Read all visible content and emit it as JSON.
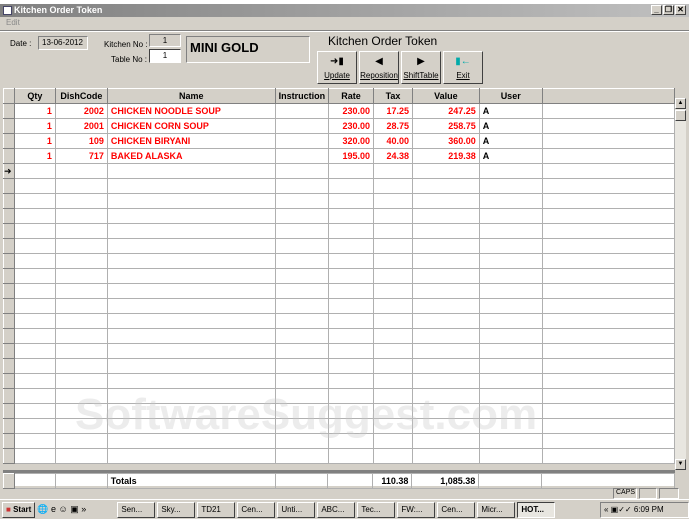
{
  "window": {
    "title": "Kitchen Order Token",
    "menu": "Edit"
  },
  "header": {
    "date_label": "Date :",
    "date": "13-06-2012",
    "kitchen_label": "Kitchen No :",
    "kitchen_no": "1",
    "table_label": "Table No :",
    "table_no": "1",
    "outlet": "MINI GOLD",
    "form_title": "Kitchen Order Token"
  },
  "buttons": [
    {
      "label": "Update",
      "icon": "door-arrow-in"
    },
    {
      "label": "Reposition",
      "icon": "arrow-left"
    },
    {
      "label": "ShiftTable",
      "icon": "arrow-right"
    },
    {
      "label": "Exit",
      "icon": "exit-door"
    }
  ],
  "columns": [
    "Qty",
    "DishCode",
    "Name",
    "Instruction",
    "Rate",
    "Tax",
    "Value",
    "User"
  ],
  "rows": [
    {
      "qty": "1",
      "code": "2002",
      "name": "CHICKEN NOODLE SOUP",
      "instr": "",
      "rate": "230.00",
      "tax": "17.25",
      "value": "247.25",
      "user": "A"
    },
    {
      "qty": "1",
      "code": "2001",
      "name": "CHICKEN CORN SOUP",
      "instr": "",
      "rate": "230.00",
      "tax": "28.75",
      "value": "258.75",
      "user": "A"
    },
    {
      "qty": "1",
      "code": "109",
      "name": "CHICKEN BIRYANI",
      "instr": "",
      "rate": "320.00",
      "tax": "40.00",
      "value": "360.00",
      "user": "A"
    },
    {
      "qty": "1",
      "code": "717",
      "name": "BAKED ALASKA",
      "instr": "",
      "rate": "195.00",
      "tax": "24.38",
      "value": "219.38",
      "user": "A"
    }
  ],
  "totals": {
    "label": "Totals",
    "tax": "110.38",
    "value": "1,085.38"
  },
  "status": {
    "caps": "CAPS"
  },
  "taskbar": {
    "start": "Start",
    "items": [
      "Sen...",
      "Sky...",
      "TD21",
      "Cen...",
      "Unti...",
      "ABC...",
      "Tec...",
      "FW:...",
      "Cen...",
      "Micr...",
      "HOT..."
    ],
    "clock": "6:09 PM"
  },
  "watermark": "SoftwareSuggest.com"
}
